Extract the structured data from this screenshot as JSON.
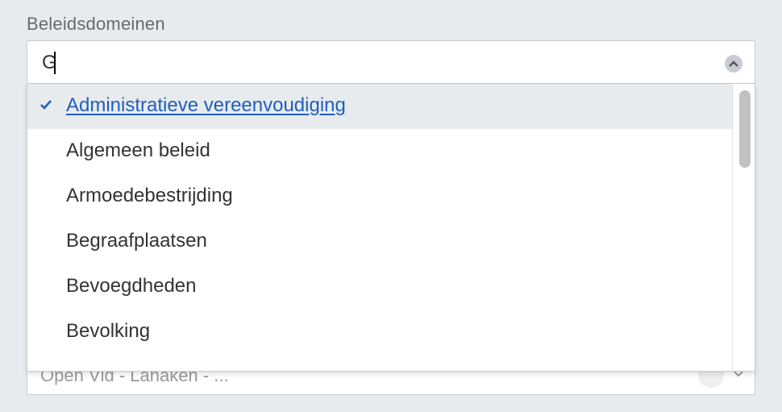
{
  "field": {
    "label": "Beleidsdomeinen",
    "input_value": "G"
  },
  "icons": {
    "toggle": "chevron-up-icon",
    "check": "checkmark-icon"
  },
  "options": [
    {
      "label": "Administratieve vereenvoudiging",
      "selected": true
    },
    {
      "label": "Algemeen beleid",
      "selected": false
    },
    {
      "label": "Armoedebestrijding",
      "selected": false
    },
    {
      "label": "Begraafplaatsen",
      "selected": false
    },
    {
      "label": "Bevoegdheden",
      "selected": false
    },
    {
      "label": "Bevolking",
      "selected": false
    }
  ],
  "behind_field": {
    "partial_text": "Open Vld - Lanaken - ..."
  },
  "colors": {
    "selected_text": "#1f5fc0",
    "selected_bg": "#e8ebee",
    "page_bg": "#e8ebee"
  }
}
